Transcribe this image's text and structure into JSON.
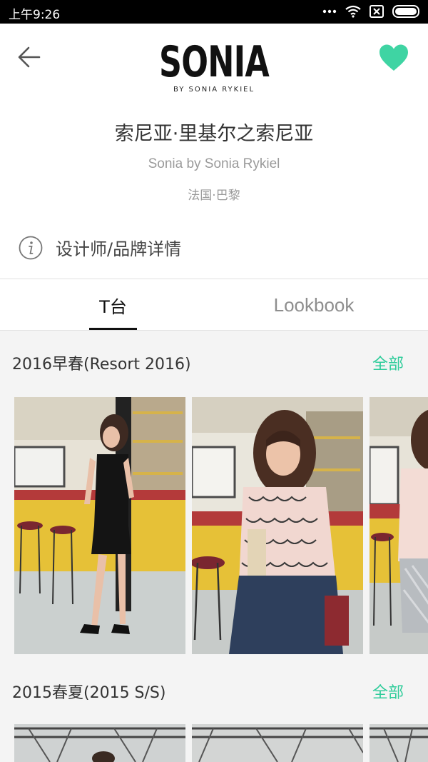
{
  "status_bar": {
    "time": "上午9:26"
  },
  "header": {
    "logo_main": "SONIA",
    "logo_sub": "BY SONIA RYKIEL",
    "brand_name_cn": "索尼亚·里基尔之索尼亚",
    "brand_name_en": "Sonia by Sonia Rykiel",
    "location": "法国·巴黎",
    "detail_link": "设计师/品牌详情"
  },
  "tabs": [
    {
      "label": "T台",
      "active": true
    },
    {
      "label": "Lookbook",
      "active": false
    }
  ],
  "collections": [
    {
      "title": "2016早春(Resort 2016)",
      "all_label": "全部"
    },
    {
      "title": "2015春夏(2015 S/S)",
      "all_label": "全部"
    }
  ],
  "colors": {
    "accent": "#2ecc9a",
    "heart": "#3fd4a3"
  },
  "icons": [
    "back-arrow-icon",
    "heart-icon",
    "info-icon",
    "wifi-icon",
    "signal-dots-icon",
    "sim-off-icon",
    "battery-icon"
  ]
}
